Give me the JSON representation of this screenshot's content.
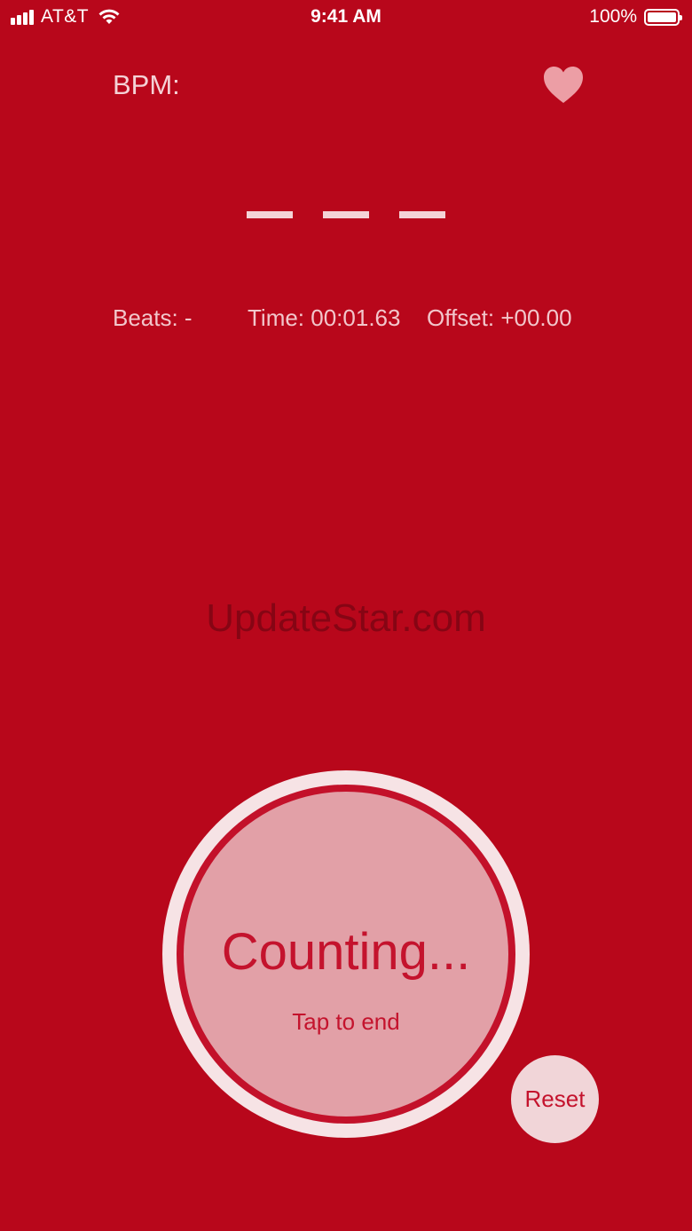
{
  "status_bar": {
    "carrier": "AT&T",
    "time": "9:41 AM",
    "battery": "100%"
  },
  "header": {
    "bpm_label": "BPM:",
    "favorite_icon": "heart-icon"
  },
  "readout": {
    "bpm_value": "— — —"
  },
  "stats": {
    "beats": "Beats: -",
    "time": "Time: 00:01.63",
    "offset": "Offset: +00.00"
  },
  "watermark": "UpdateStar.com",
  "tap_button": {
    "title": "Counting...",
    "hint": "Tap to end"
  },
  "reset_button": {
    "label": "Reset"
  },
  "colors": {
    "background": "#b8071b",
    "tap_fill": "#e2a0a7",
    "accent_text": "#c4132d",
    "light": "#f4d2d6"
  }
}
